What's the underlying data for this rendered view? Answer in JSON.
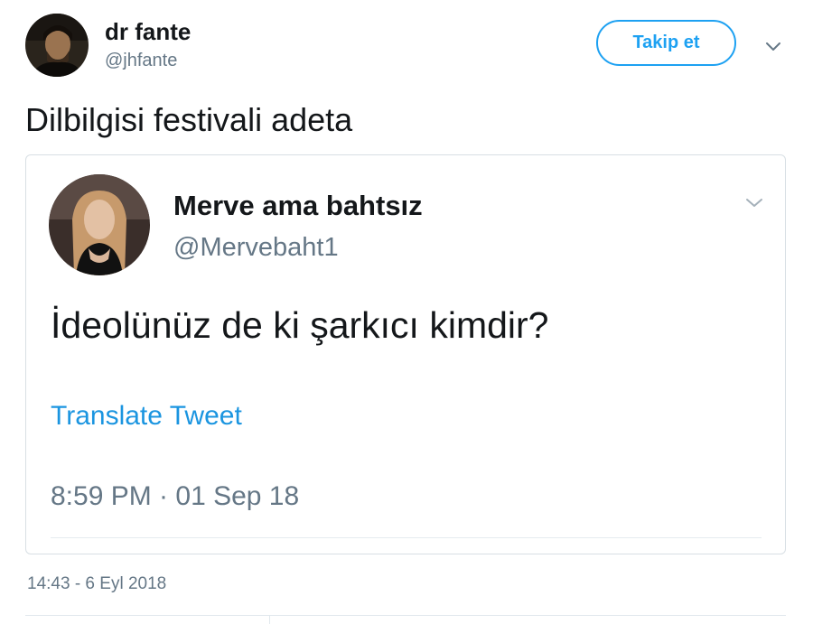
{
  "tweet": {
    "author_name": "dr fante",
    "author_handle": "@jhfante",
    "follow_label": "Takip et",
    "text": "Dilbilgisi festivali adeta",
    "timestamp": "14:43 - 6 Eyl 2018",
    "avatar_icon": "portrait-avatar",
    "caret_icon": "chevron-down-icon"
  },
  "quoted": {
    "author_name": "Merve ama bahtsız",
    "author_handle": "@Mervebaht1",
    "text": "İdeolünüz de ki şarkıcı kimdir?",
    "translate_label": "Translate Tweet",
    "timestamp": "8:59 PM · 01 Sep 18",
    "avatar_icon": "portrait-avatar"
  },
  "colors": {
    "accent": "#1da1f2",
    "link": "#1b95e0",
    "muted_text": "#657786",
    "border": "#d8dfe4"
  }
}
